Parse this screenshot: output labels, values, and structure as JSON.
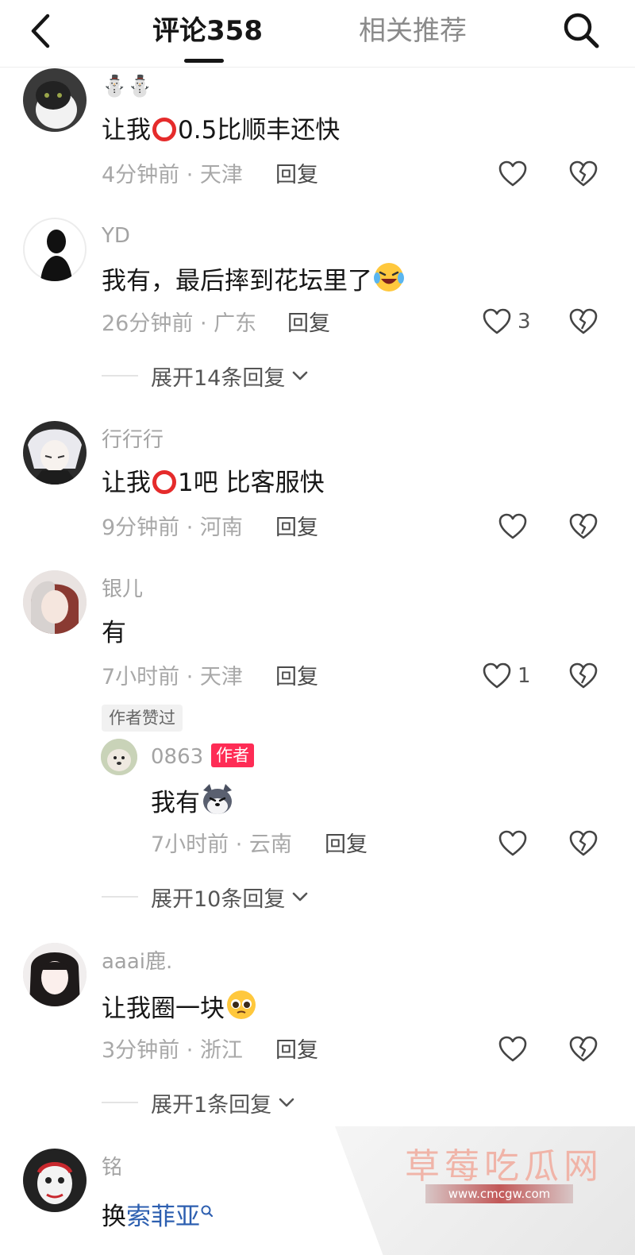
{
  "header": {
    "tab_comments": "评论358",
    "tab_related": "相关推荐"
  },
  "comments": [
    {
      "username": "⛄⛄",
      "text_before": "让我",
      "text_after": "0.5比顺丰还快",
      "time_location": "4分钟前 · 天津",
      "reply": "回复"
    },
    {
      "username": "YD",
      "text_before": "我有，最后摔到花坛里了",
      "time_location": "26分钟前 · 广东",
      "reply": "回复",
      "likes": "3",
      "expand": "展开14条回复"
    },
    {
      "username": "行行行",
      "text_before": "让我",
      "text_after": "1吧 比客服快",
      "time_location": "9分钟前 · 河南",
      "reply": "回复"
    },
    {
      "username": "银儿",
      "text_before": "有",
      "time_location": "7小时前 · 天津",
      "reply": "回复",
      "likes": "1",
      "liked_badge": "作者赞过",
      "sub_reply": {
        "username": "0863",
        "badge": "作者",
        "text_before": "我有",
        "time_location": "7小时前 · 云南",
        "reply": "回复"
      },
      "expand": "展开10条回复"
    },
    {
      "username": "aaai鹿.",
      "text_before": "让我圈一块",
      "time_location": "3分钟前 · 浙江",
      "reply": "回复",
      "expand": "展开1条回复"
    },
    {
      "username": "铭",
      "text_before": "换",
      "link": "索菲亚"
    }
  ],
  "watermark": {
    "title": "草莓吃瓜网",
    "url": "www.cmcgw.com"
  },
  "colors": {
    "accent": "#fe2c55",
    "link": "#2d5fb0",
    "muted": "#a8a8a8"
  }
}
